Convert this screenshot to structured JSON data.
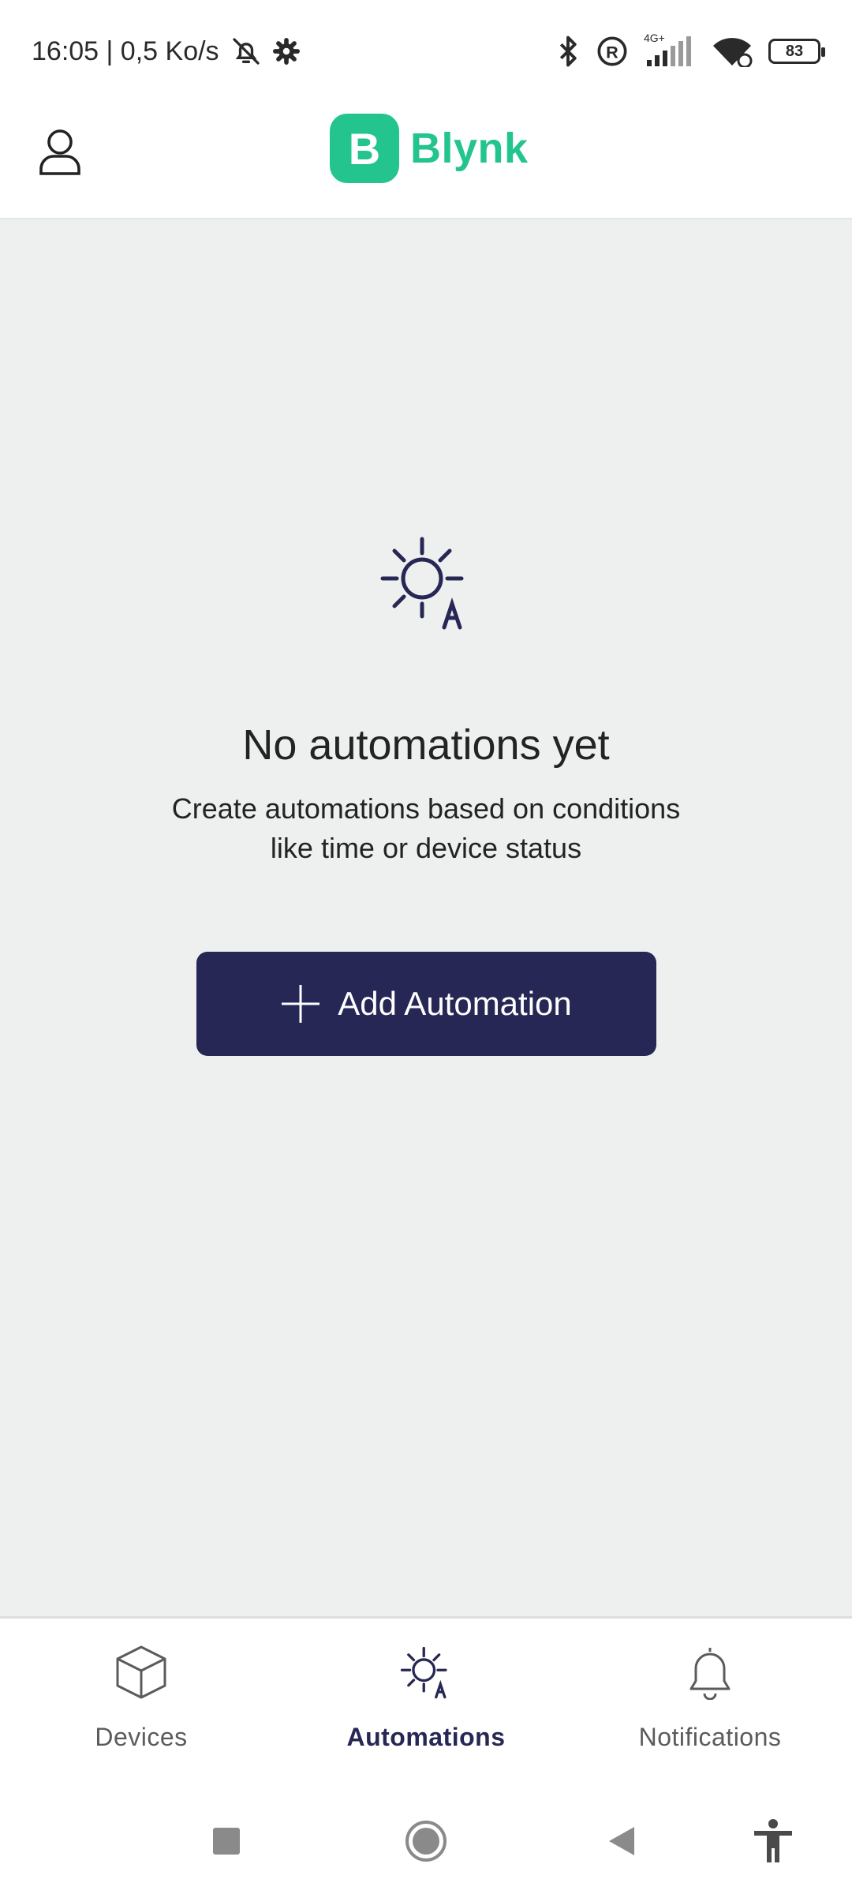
{
  "status_bar": {
    "time_speed": "16:05 | 0,5 Ko/s",
    "network_label": "4G+",
    "battery": "83",
    "icons": [
      "bell-off-icon",
      "gear-icon",
      "bluetooth-icon",
      "roaming-icon",
      "signal-icon",
      "wifi-icon",
      "battery-icon"
    ]
  },
  "header": {
    "logo_mark": "B",
    "logo_text": "Blynk",
    "brand_color": "#23c48e"
  },
  "empty_state": {
    "title": "No automations yet",
    "description_line1": "Create automations based on conditions",
    "description_line2": "like time or device status",
    "button_label": "Add Automation",
    "button_color": "#262754"
  },
  "bottom_nav": {
    "items": [
      {
        "label": "Devices",
        "icon": "cube-icon",
        "active": false
      },
      {
        "label": "Automations",
        "icon": "sun-automation-icon",
        "active": true
      },
      {
        "label": "Notifications",
        "icon": "bell-icon",
        "active": false
      }
    ]
  },
  "system_nav": {
    "icons": [
      "recents-square-icon",
      "home-circle-icon",
      "back-triangle-icon",
      "accessibility-icon"
    ]
  }
}
